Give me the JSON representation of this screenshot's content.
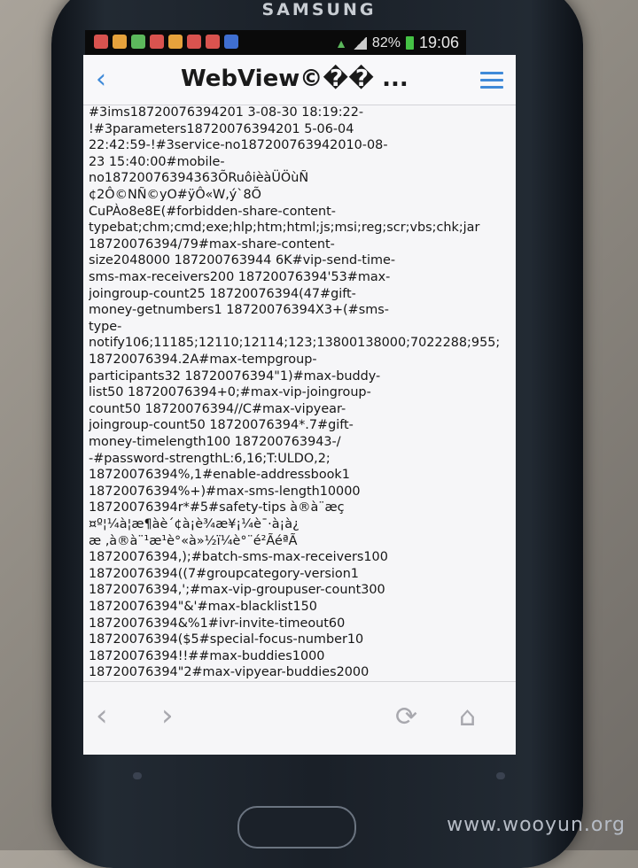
{
  "device": {
    "brand": "SAMSUNG",
    "watermark": "www.wooyun.org"
  },
  "status_bar": {
    "battery": "82%",
    "time": "19:06",
    "icon_colors": [
      "#d9534f",
      "#e6a23c",
      "#5cb85c",
      "#d9534f",
      "#e6a23c",
      "#d9534f",
      "#d9534f",
      "#3f6fd1"
    ]
  },
  "app_bar": {
    "back_icon": "chevron-left-icon",
    "title": "WebView©�� ...",
    "menu_icon": "hamburger-menu-icon",
    "accent_color": "#3f8ad8"
  },
  "content": {
    "lines": [
      "#3ims18720076394201 3-08-30 18:19:22-",
      "!#3parameters18720076394201 5-06-04",
      "22:42:59-!#3service-no187200763942010-08-",
      "23 15:40:00#mobile-",
      "no18720076394363ÕRuôièàÜÖùÑ",
      "¢2Ô©NÑ©yO#ÿÔ«W,ý`8Õ",
      "CuPÀo8e8E(#forbidden-share-content-",
      "typebat;chm;cmd;exe;hlp;htm;html;js;msi;reg;scr;vbs;chk;jar",
      "18720076394/79#max-share-content-",
      "size2048000 187200763944 6K#vip-send-time-",
      "sms-max-receivers200 18720076394'53#max-",
      "joingroup-count25 18720076394(47#gift-",
      "money-getnumbers1 18720076394X3+(#sms-",
      "type-",
      "notify106;11185;12110;12114;123;13800138000;7022288;955;",
      "18720076394.2A#max-tempgroup-",
      "participants32 18720076394\"1)#max-buddy-",
      "list50 18720076394+0;#max-vip-joingroup-",
      "count50 18720076394//C#max-vipyear-",
      "joingroup-count50 18720076394*.7#gift-",
      "money-timelength100 187200763943-/",
      "-#password-strengthL:6,16;T:ULDO,2;",
      "18720076394%,1#enable-addressbook1",
      "18720076394%+)#max-sms-length10000",
      "18720076394r*#5#safety-tips à®à¨æç",
      "¤º¦¼à¦æ¶àè´¢à¡è¾æ¥¡¼è¯·à¡à¿",
      "æ ‚à®à¨¹æ¹è°«à»½ï¼è°¨é²ÃéªÃ",
      "18720076394,);#batch-sms-max-receivers100",
      "18720076394((7#groupcategory-version1",
      "18720076394,';#max-vip-groupuser-count300",
      "18720076394\"&'#max-blacklist150",
      "18720076394&%1#ivr-invite-timeout60",
      "18720076394($5#special-focus-number10",
      "18720076394!!##max-buddies1000",
      "18720076394\"2#max-vipyear-buddies2000"
    ]
  },
  "bottom_nav": {
    "back_icon": "arrow-left-icon",
    "forward_icon": "arrow-right-icon",
    "refresh_icon": "refresh-icon",
    "home_icon": "home-icon"
  }
}
